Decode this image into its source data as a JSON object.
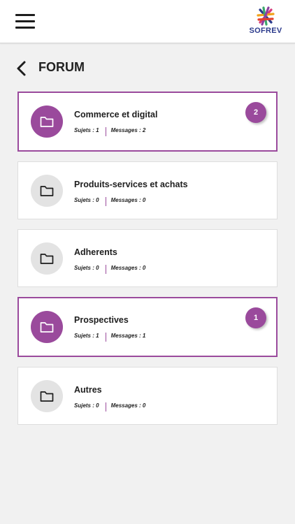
{
  "app": {
    "logo_text": "SOFREV",
    "accent_color": "#9a4a9c"
  },
  "page": {
    "title": "FORUM"
  },
  "forums": [
    {
      "name": "Commerce et digital",
      "subjects_label": "Sujets : 1",
      "messages_label": "Messages : 2",
      "badge": "2",
      "active": true
    },
    {
      "name": "Produits-services et achats",
      "subjects_label": "Sujets : 0",
      "messages_label": "Messages : 0",
      "badge": "",
      "active": false
    },
    {
      "name": "Adherents",
      "subjects_label": "Sujets : 0",
      "messages_label": "Messages : 0",
      "badge": "",
      "active": false
    },
    {
      "name": "Prospectives",
      "subjects_label": "Sujets : 1",
      "messages_label": "Messages : 1",
      "badge": "1",
      "active": true
    },
    {
      "name": "Autres",
      "subjects_label": "Sujets : 0",
      "messages_label": "Messages : 0",
      "badge": "",
      "active": false
    }
  ]
}
